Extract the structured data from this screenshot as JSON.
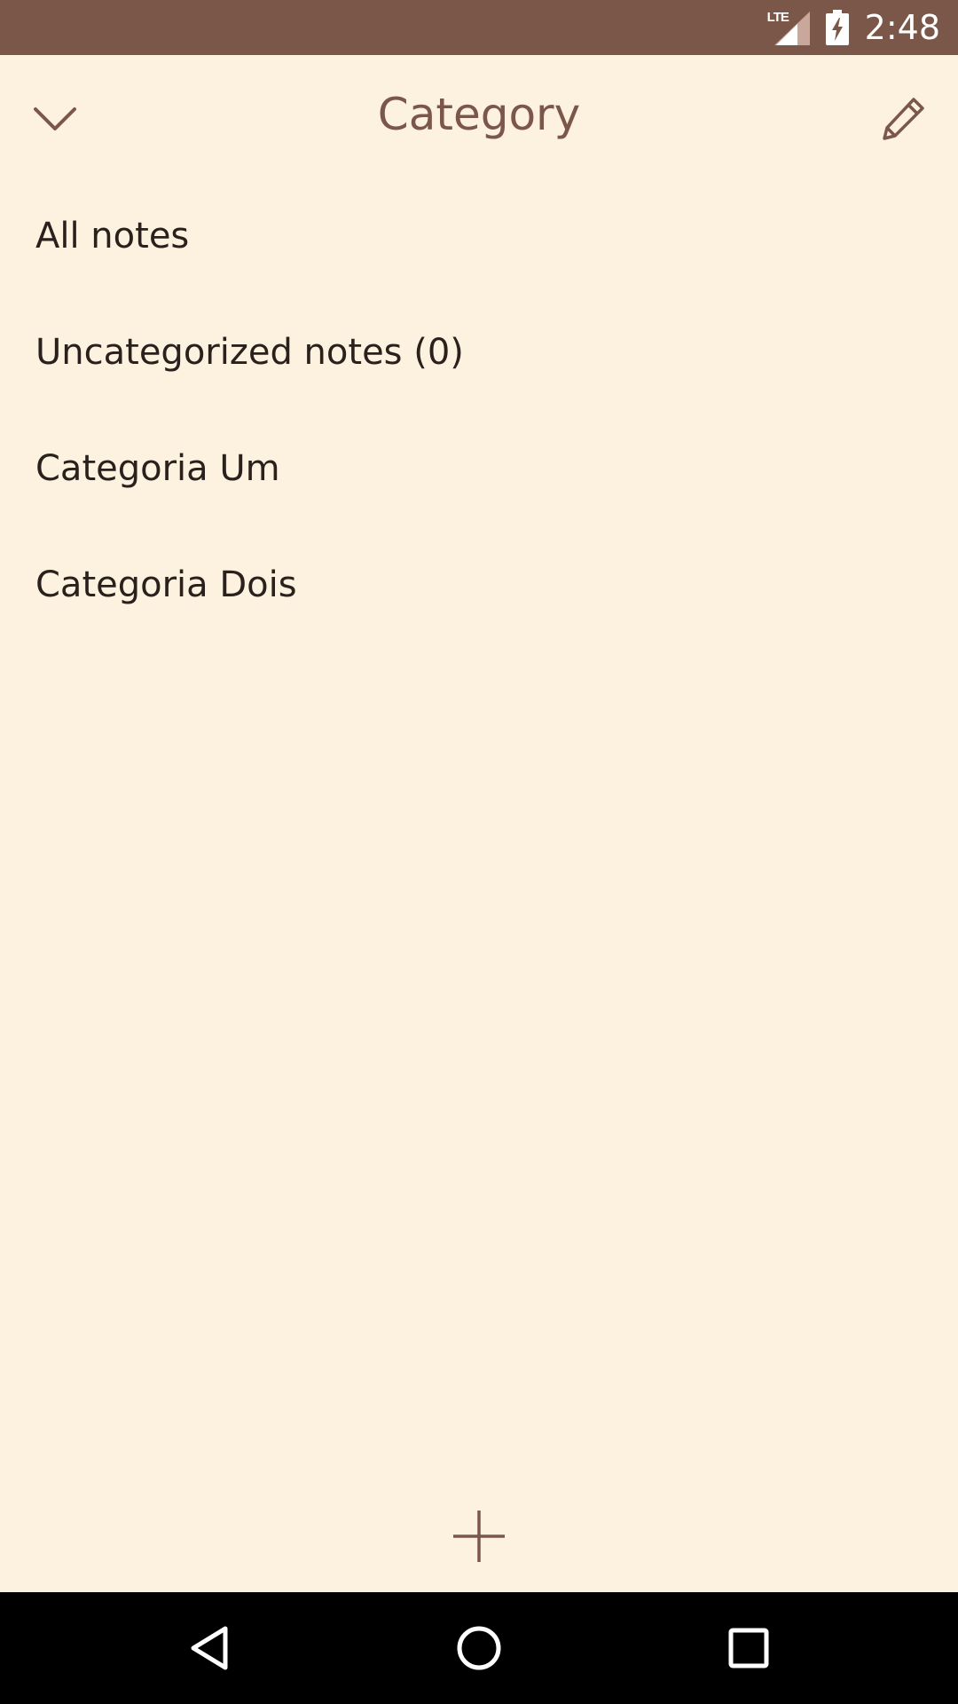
{
  "status_bar": {
    "network": "LTE",
    "time": "2:48",
    "icons": [
      "lte-signal-icon",
      "battery-charging-icon"
    ]
  },
  "header": {
    "title": "Category",
    "left_icon": "chevron-down-icon",
    "right_icon": "pencil-icon"
  },
  "categories": [
    {
      "label": "All notes"
    },
    {
      "label": "Uncategorized notes (0)"
    },
    {
      "label": "Categoria Um"
    },
    {
      "label": "Categoria Dois"
    }
  ],
  "fab": {
    "icon": "plus-icon"
  },
  "nav_bar": {
    "icons": [
      "back-icon",
      "home-icon",
      "recents-icon"
    ]
  },
  "colors": {
    "status_bar": "#7B574A",
    "background": "#FDF2E0",
    "accent": "#7B574A",
    "text": "#2A211C",
    "nav_bar": "#000000"
  }
}
